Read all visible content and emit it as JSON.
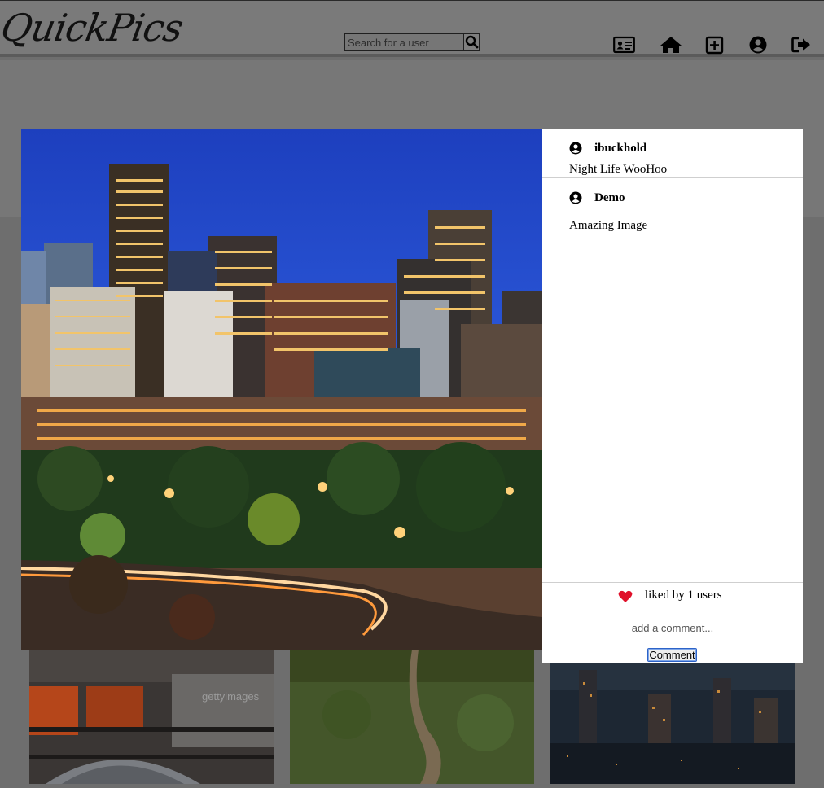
{
  "header": {
    "logo_text": "QuickPics",
    "search": {
      "placeholder": "Search for a user",
      "value": ""
    },
    "nav_icons": [
      "id-card-icon",
      "home-icon",
      "plus-square-icon",
      "user-circle-icon",
      "sign-out-icon"
    ]
  },
  "modal": {
    "post": {
      "author": "ibuckhold",
      "caption": "Night Life WooHoo"
    },
    "comments": [
      {
        "author": "Demo",
        "text": "Amazing Image"
      }
    ],
    "likes_text": "liked by 1 users",
    "comment_input": {
      "placeholder": "add a comment...",
      "value": ""
    },
    "comment_button": "Comment"
  },
  "colors": {
    "overlay": "#6e6e6e",
    "heart": "#e0102a",
    "focus_ring": "#2d63c8"
  }
}
